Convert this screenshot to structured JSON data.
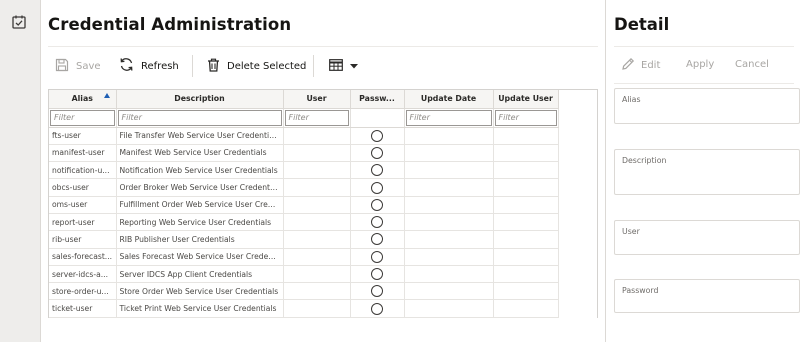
{
  "page": {
    "title": "Credential Administration"
  },
  "toolbar": {
    "save_label": "Save",
    "refresh_label": "Refresh",
    "delete_label": "Delete Selected"
  },
  "table": {
    "columns": [
      "Alias",
      "Description",
      "User",
      "Passw...",
      "Update Date",
      "Update User"
    ],
    "filter_placeholder": "Filter",
    "rows": [
      {
        "alias": "fts-user",
        "description": "File Transfer Web Service User Credentials"
      },
      {
        "alias": "manifest-user",
        "description": "Manifest Web Service User Credentials"
      },
      {
        "alias": "notification-u...",
        "description": "Notification Web Service User Credentials"
      },
      {
        "alias": "obcs-user",
        "description": "Order Broker Web Service User Credentials"
      },
      {
        "alias": "oms-user",
        "description": "Fulfillment Order Web Service User Crede..."
      },
      {
        "alias": "report-user",
        "description": "Reporting Web Service User Credentials"
      },
      {
        "alias": "rib-user",
        "description": "RIB Publisher User Credentials"
      },
      {
        "alias": "sales-forecast...",
        "description": "Sales Forecast Web Service User Credentials"
      },
      {
        "alias": "server-idcs-a...",
        "description": "Server IDCS App Client Credentials"
      },
      {
        "alias": "store-order-u...",
        "description": "Store Order Web Service User Credentials"
      },
      {
        "alias": "ticket-user",
        "description": "Ticket Print Web Service User Credentials"
      }
    ]
  },
  "detail": {
    "title": "Detail",
    "edit_label": "Edit",
    "apply_label": "Apply",
    "cancel_label": "Cancel",
    "fields": {
      "alias_label": "Alias",
      "description_label": "Description",
      "user_label": "User",
      "password_label": "Password"
    }
  },
  "colors": {
    "accent": "#1f5fb4",
    "sidebar": "#eeedeb",
    "disabled_text": "#a8a6a3"
  },
  "icons": [
    "task-list-icon",
    "save-icon",
    "refresh-icon",
    "trash-icon",
    "grid-view-icon",
    "chevron-down-icon",
    "pencil-icon",
    "sort-ascending-icon",
    "radio-circle-icon"
  ]
}
